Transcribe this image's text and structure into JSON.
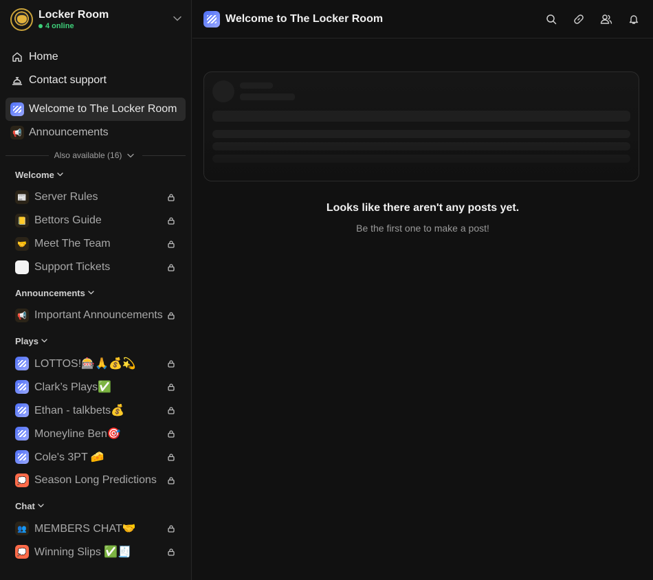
{
  "server": {
    "name": "Locker Room",
    "online": "4 online"
  },
  "nav": [
    {
      "label": "Home",
      "icon": "home-icon"
    },
    {
      "label": "Contact support",
      "icon": "bell-desk-icon"
    }
  ],
  "pinned": [
    {
      "label": "Welcome to The Locker Room",
      "icon": "blue-feed-icon",
      "active": true
    },
    {
      "label": "Announcements",
      "icon": "megaphone-icon",
      "active": false
    }
  ],
  "also_available": "Also available (16)",
  "categories": [
    {
      "name": "Welcome",
      "channels": [
        {
          "label": "Server Rules",
          "chip": "dark",
          "emoji": "📰"
        },
        {
          "label": "Bettors Guide",
          "chip": "dark",
          "emoji": "📒"
        },
        {
          "label": "Meet The Team",
          "chip": "dark",
          "emoji": "🤝"
        },
        {
          "label": "Support Tickets",
          "chip": "white",
          "emoji": ""
        }
      ]
    },
    {
      "name": "Announcements",
      "channels": [
        {
          "label": "Important Announcements",
          "chip": "dark",
          "emoji": "📢"
        }
      ]
    },
    {
      "name": "Plays",
      "channels": [
        {
          "label": "LOTTOS!🎰🙏💰💫",
          "chip": "blue",
          "emoji": ""
        },
        {
          "label": "Clark’s Plays✅",
          "chip": "blue",
          "emoji": ""
        },
        {
          "label": "Ethan - talkbets💰",
          "chip": "blue",
          "emoji": ""
        },
        {
          "label": "Moneyline Ben🎯",
          "chip": "blue",
          "emoji": ""
        },
        {
          "label": "Cole's 3PT 🧀",
          "chip": "blue",
          "emoji": ""
        },
        {
          "label": "Season Long Predictions",
          "chip": "salmon",
          "emoji": "💭"
        }
      ]
    },
    {
      "name": "Chat",
      "channels": [
        {
          "label": "MEMBERS CHAT🤝",
          "chip": "dark",
          "emoji": "👥"
        },
        {
          "label": "Winning Slips ✅🧾",
          "chip": "salmon",
          "emoji": "💭"
        }
      ]
    }
  ],
  "header": {
    "title": "Welcome to The Locker Room"
  },
  "empty": {
    "title": "Looks like there aren't any posts yet.",
    "subtitle": "Be the first one to make a post!"
  },
  "colors": {
    "online": "#3fd07a",
    "accent_blue": "#4c6ef5",
    "background": "#121212"
  }
}
